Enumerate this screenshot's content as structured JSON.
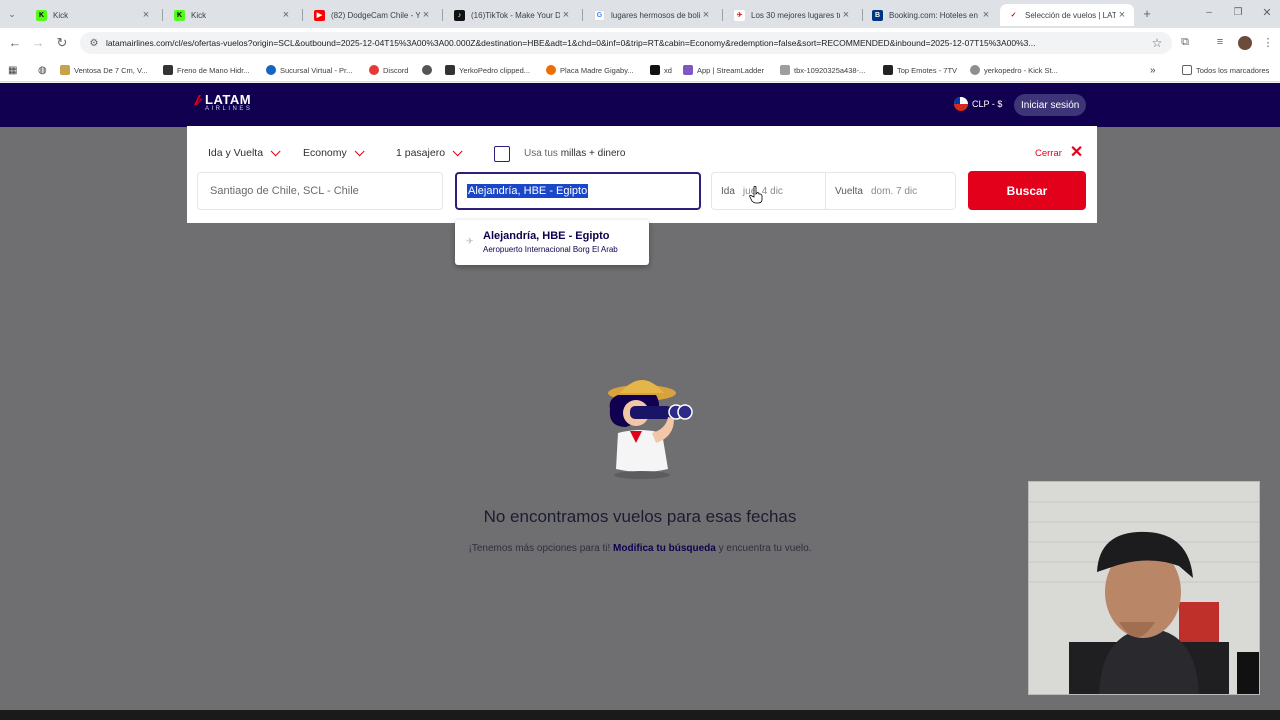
{
  "browser": {
    "tabs": [
      {
        "title": "Kick",
        "favicon_color": "#53fc18",
        "favicon_glyph": "K"
      },
      {
        "title": "Kick",
        "favicon_color": "#53fc18",
        "favicon_glyph": "K"
      },
      {
        "title": "(82) DodgeCam Chile - Yo",
        "favicon_color": "#ff0000",
        "favicon_glyph": "▶"
      },
      {
        "title": "(16)TikTok - Make Your Da",
        "favicon_color": "#111111",
        "favicon_glyph": "♪"
      },
      {
        "title": "lugares hermosos de boli",
        "favicon_color": "#4285f4",
        "favicon_glyph": "G"
      },
      {
        "title": "Los 30 mejores lugares tu",
        "favicon_color": "#d32323",
        "favicon_glyph": "✈"
      },
      {
        "title": "Booking.com: Hoteles en",
        "favicon_color": "#003580",
        "favicon_glyph": "B"
      },
      {
        "title": "Selección de vuelos | LAT",
        "favicon_color": "#e3001b",
        "favicon_glyph": "✓"
      }
    ],
    "new_tab_symbol": "+",
    "url": "latamairlines.com/cl/es/ofertas-vuelos?origin=SCL&outbound=2025-12-04T15%3A00%3A00.000Z&destination=HBE&adt=1&chd=0&inf=0&trip=RT&cabin=Economy&redemption=false&sort=RECOMMENDED&inbound=2025-12-07T15%3A00%3...",
    "bookmarks": [
      {
        "label": "Ventosa De 7 Cm, V...",
        "color": "#c8a24a"
      },
      {
        "label": "Freno de Mano Hidr...",
        "color": "#333333"
      },
      {
        "label": "Sucursal Virtual - Pr...",
        "color": "#1565c0"
      },
      {
        "label": "Discord",
        "color": "#e53935"
      },
      {
        "label": "YerkoPedro clipped...",
        "color": "#333333"
      },
      {
        "label": "Placa Madre Gigaby...",
        "color": "#ef6c00"
      },
      {
        "label": "xd",
        "color": "#111111"
      },
      {
        "label": "App | StreamLadder",
        "color": "#7e57c2"
      },
      {
        "label": "tbx-10920325a438-...",
        "color": "#9e9e9e"
      },
      {
        "label": "Top Emotes - 7TV",
        "color": "#222222"
      },
      {
        "label": "yerkopedro - Kick St...",
        "color": "#8e8e8e"
      }
    ],
    "all_bookmarks": "Todos los marcadores"
  },
  "header": {
    "logo_main": "LATAM",
    "logo_sub": "AIRLINES",
    "currency": "CLP - $",
    "login": "Iniciar sesión"
  },
  "search": {
    "trip_type": "Ida y Vuelta",
    "cabin": "Economy",
    "passengers": "1 pasajero",
    "miles_label_prefix": "Usa tus ",
    "miles_label_bold": "millas + dinero",
    "close_label": "Cerrar",
    "origin_value": "Santiago de Chile, SCL - Chile",
    "destination_value": "Alejandría, HBE - Egipto",
    "outbound_label": "Ida",
    "outbound_value": "jue. 4 dic",
    "inbound_label": "Vuelta",
    "inbound_value": "dom. 7 dic",
    "search_button": "Buscar",
    "suggestion": {
      "title": "Alejandría, HBE - Egipto",
      "subtitle": "Aeropuerto Internacional Borg El Arab"
    }
  },
  "empty_state": {
    "title": "No encontramos vuelos para esas fechas",
    "sub_prefix": "¡Tenemos más opciones para ti! ",
    "sub_link": "Modifica tu búsqueda",
    "sub_suffix": " y encuentra tu vuelo."
  },
  "colors": {
    "brand_navy": "#10004f",
    "brand_red": "#e3001b",
    "selection_blue": "#1a47c8"
  }
}
